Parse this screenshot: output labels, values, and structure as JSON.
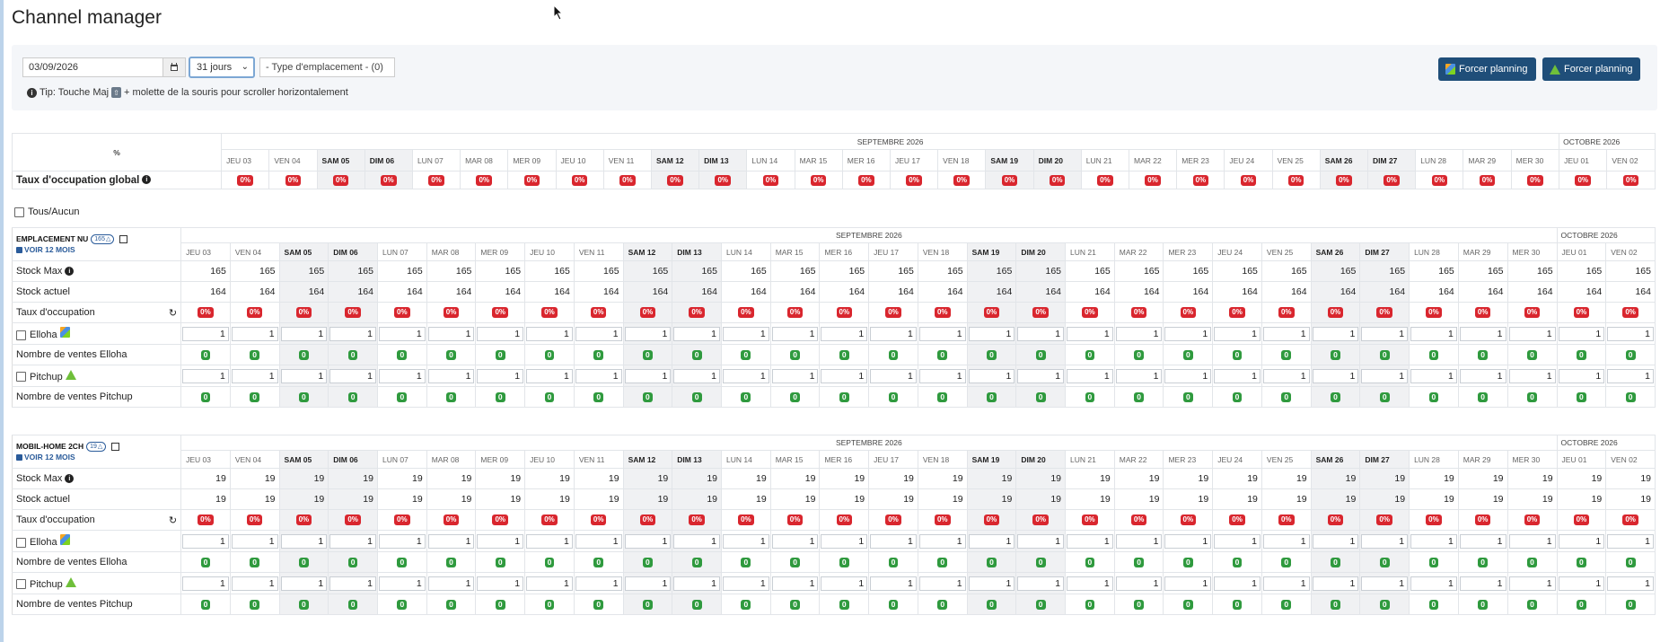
{
  "page_title": "Channel manager",
  "filters": {
    "date_value": "03/09/2026",
    "days_selected": "31 jours",
    "type_select": "- Type d'emplacement - (0)",
    "tip_prefix": "Tip: Touche Maj",
    "tip_suffix": "+ molette de la souris pour scroller horizontalement"
  },
  "actions": {
    "force_elloha": "Forcer planning",
    "force_pitchup": "Forcer planning"
  },
  "months": {
    "sept": "SEPTEMBRE 2026",
    "oct": "OCTOBRE 2026"
  },
  "days": [
    "JEU 03",
    "VEN 04",
    "SAM 05",
    "DIM 06",
    "LUN 07",
    "MAR 08",
    "MER 09",
    "JEU 10",
    "VEN 11",
    "SAM 12",
    "DIM 13",
    "LUN 14",
    "MAR 15",
    "MER 16",
    "JEU 17",
    "VEN 18",
    "SAM 19",
    "DIM 20",
    "LUN 21",
    "MAR 22",
    "MER 23",
    "JEU 24",
    "VEN 25",
    "SAM 26",
    "DIM 27",
    "LUN 28",
    "MAR 29",
    "MER 30",
    "JEU 01",
    "VEN 02"
  ],
  "weekend_index": [
    2,
    3,
    9,
    10,
    16,
    17,
    23,
    24
  ],
  "global": {
    "label": "Taux d'occupation global",
    "value": "0%"
  },
  "tous_aucun": "Tous/Aucun",
  "sections": [
    {
      "title": "EMPLACEMENT NU",
      "count": "165",
      "voir": "VOIR 12 MOIS",
      "stock_max_label": "Stock Max",
      "stock_max": "165",
      "stock_actuel_label": "Stock actuel",
      "stock_actuel": "164",
      "taux_label": "Taux d'occupation",
      "taux": "0%",
      "elloha_label": "Elloha",
      "elloha_value": "1",
      "ventes_elloha_label": "Nombre de ventes Elloha",
      "ventes_elloha": "0",
      "pitchup_label": "Pitchup",
      "pitchup_value": "1",
      "ventes_pitchup_label": "Nombre de ventes Pitchup",
      "ventes_pitchup": "0"
    },
    {
      "title": "MOBIL-HOME 2CH",
      "count": "19",
      "voir": "VOIR 12 MOIS",
      "stock_max_label": "Stock Max",
      "stock_max": "19",
      "stock_actuel_label": "Stock actuel",
      "stock_actuel": "19",
      "taux_label": "Taux d'occupation",
      "taux": "0%",
      "elloha_label": "Elloha",
      "elloha_value": "1",
      "ventes_elloha_label": "Nombre de ventes Elloha",
      "ventes_elloha": "0",
      "pitchup_label": "Pitchup",
      "pitchup_value": "1",
      "ventes_pitchup_label": "Nombre de ventes Pitchup",
      "ventes_pitchup": "0"
    }
  ],
  "colors": {
    "primary": "#1f4e79",
    "danger": "#d9262e",
    "success": "#2f9a3e",
    "weekend": "#f0f1f3"
  },
  "icons": {
    "calendar": "calendar-icon",
    "info": "info-icon",
    "sync": "sync-icon",
    "external": "external-link-icon",
    "percent": "percent-icon"
  }
}
